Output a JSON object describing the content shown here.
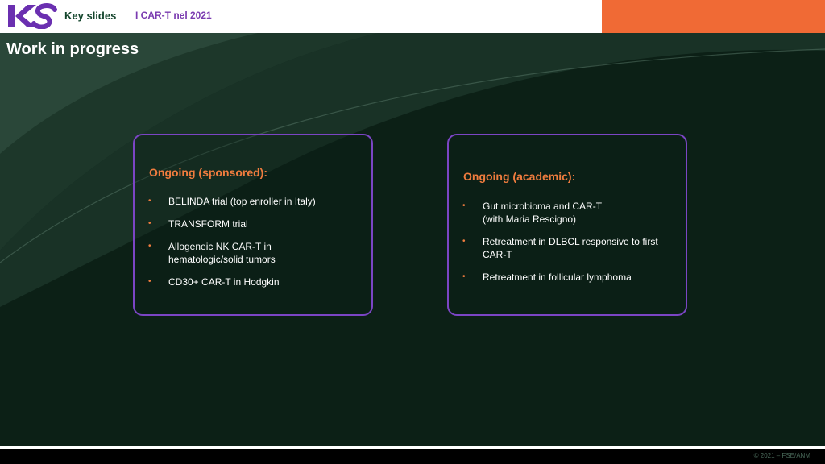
{
  "header": {
    "brand": "Key slides",
    "subtitle": "I CAR-T nel 2021"
  },
  "page_title": "Work in progress",
  "cards": [
    {
      "title": "Ongoing (sponsored):",
      "items": [
        "BELINDA trial (top enroller in Italy)",
        "TRANSFORM trial",
        "Allogeneic NK CAR-T in\nhematologic/solid tumors",
        "CD30+ CAR-T in Hodgkin"
      ]
    },
    {
      "title": "Ongoing (academic):",
      "items": [
        "Gut microbioma and CAR-T\n(with Maria Rescigno)",
        "Retreatment in DLBCL responsive to first\nCAR-T",
        "Retreatment in follicular lymphoma"
      ]
    }
  ],
  "footer": {
    "copyright": "© 2021 – FSE/ANM"
  },
  "colors": {
    "background": "#0c2016",
    "accent_orange": "#f06a35",
    "card_border": "#7b45c4",
    "brand_green": "#13452c",
    "subtitle_purple": "#7a3bb0"
  },
  "icons": {
    "logo": "ks-logo",
    "bullet": "bullet-icon"
  }
}
